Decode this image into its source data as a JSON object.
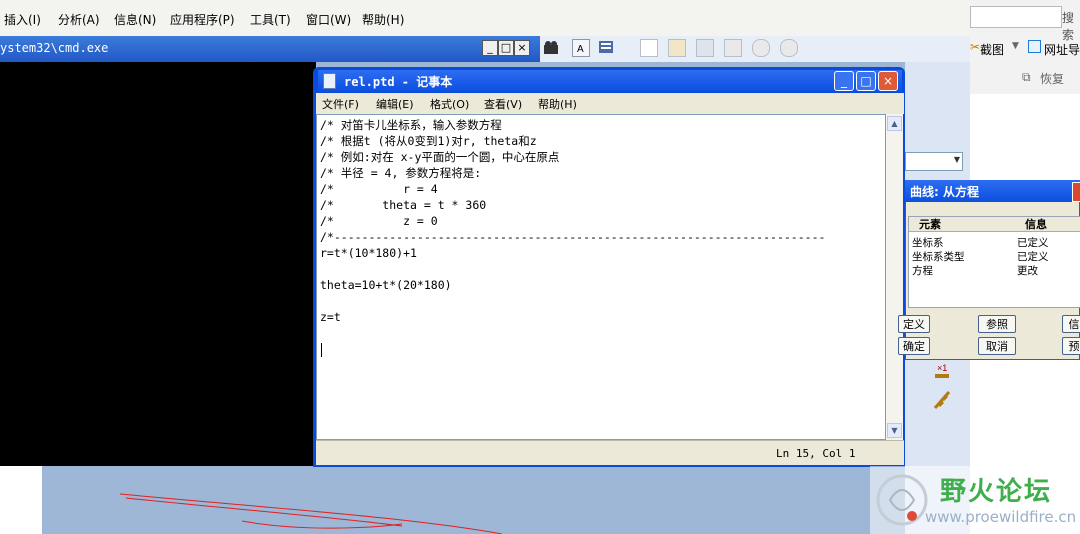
{
  "proe": {
    "menu": [
      "插入(I)",
      "分析(A)",
      "信息(N)",
      "应用程序(P)",
      "工具(T)",
      "窗口(W)",
      "帮助(H)"
    ]
  },
  "cmd": {
    "title": "ystem32\\cmd.exe",
    "buttons": [
      "_",
      "□",
      "×"
    ]
  },
  "notepad": {
    "title": "rel.ptd - 记事本",
    "menu": [
      "文件(F)",
      "编辑(E)",
      "格式(O)",
      "查看(V)",
      "帮助(H)"
    ],
    "lines": [
      "/* 对笛卡儿坐标系，输入参数方程",
      "/* 根据t (将从0变到1)对r, theta和z",
      "/* 例如:对在 x-y平面的一个圆，中心在原点",
      "/* 半径 = 4, 参数方程将是:",
      "/*          r = 4",
      "/*       theta = t * 360",
      "/*          z = 0",
      "/*-----------------------------------------------------------------------",
      "r=t*(10*180)+1",
      "",
      "theta=10+t*(20*180)",
      "",
      "z=t",
      "",
      ""
    ],
    "status": "Ln 15, Col 1"
  },
  "dialog": {
    "title": "曲线: 从方程",
    "col_element": "元素",
    "col_info": "信息",
    "rows": [
      {
        "element": "坐标系",
        "info": "已定义"
      },
      {
        "element": "坐标系类型",
        "info": "已定义"
      },
      {
        "element": "方程",
        "info": "更改"
      }
    ],
    "btn_define": "定义",
    "btn_ref": "参照",
    "btn_info": "信",
    "btn_ok": "确定",
    "btn_cancel": "取消",
    "btn_preview": "预"
  },
  "browser": {
    "search": "搜索",
    "screenshot": "截图",
    "url": "网址导",
    "restore": "恢复"
  },
  "watermark": {
    "name": "野火论坛",
    "url": "www.proewildfire.cn"
  }
}
